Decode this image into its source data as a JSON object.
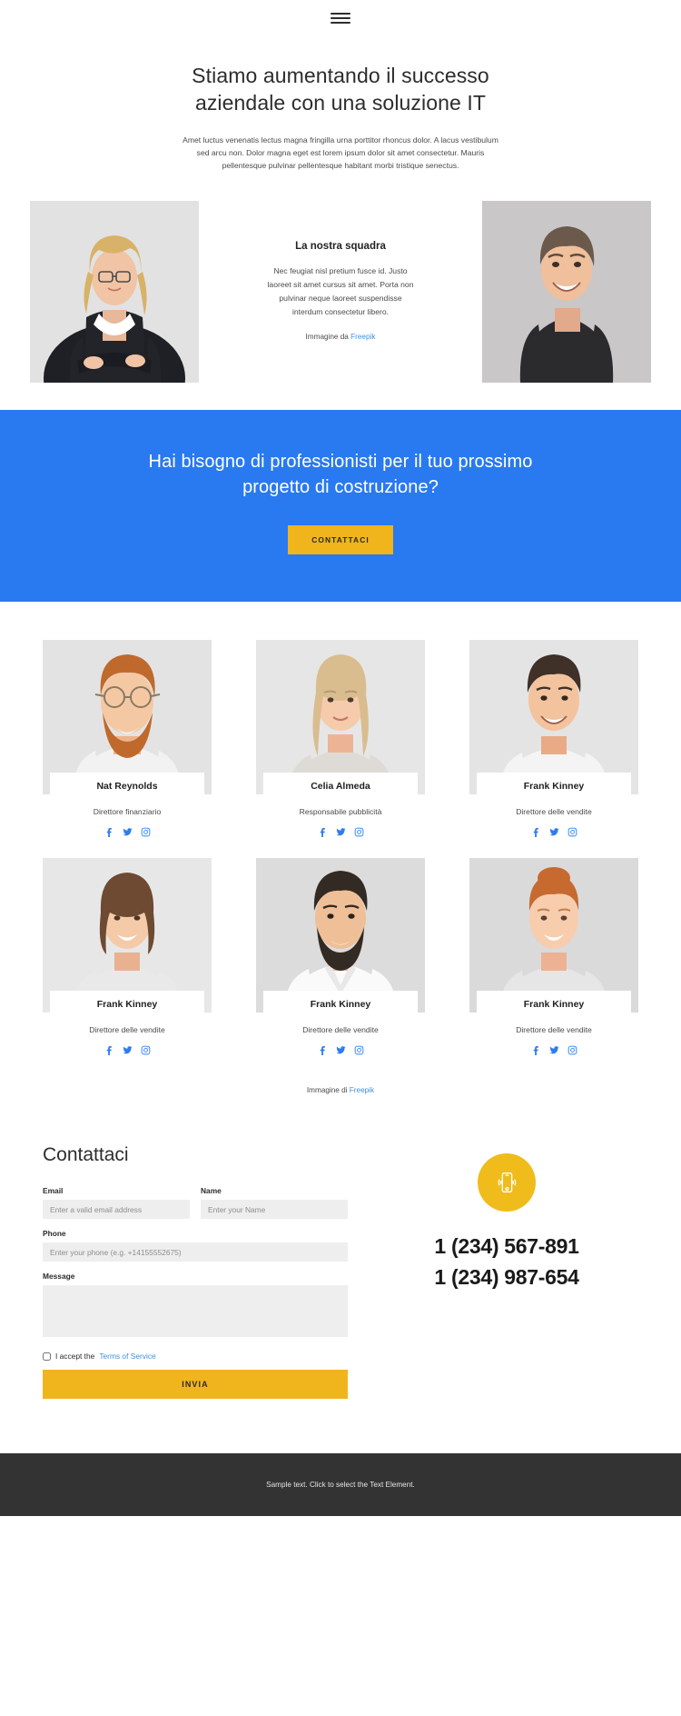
{
  "header": {
    "menu_icon": "hamburger-menu-icon"
  },
  "hero": {
    "title": "Stiamo aumentando il successo aziendale con una soluzione IT",
    "subtitle": "Amet luctus venenatis lectus magna fringilla urna porttitor rhoncus dolor. A lacus vestibulum sed arcu non. Dolor magna eget est lorem ipsum dolor sit amet consectetur. Mauris pellentesque pulvinar pellentesque habitant morbi tristique senectus."
  },
  "intro": {
    "heading": "La nostra squadra",
    "body": "Nec feugiat nisl pretium fusce id. Justo laoreet sit amet cursus sit amet. Porta non pulvinar neque laoreet suspendisse interdum consectetur libero.",
    "credit_prefix": "Immagine da ",
    "credit_link": "Freepik"
  },
  "cta": {
    "heading": "Hai bisogno di professionisti per il tuo prossimo progetto di costruzione?",
    "button_label": "CONTATTACI"
  },
  "team": {
    "members": [
      {
        "name": "Nat Reynolds",
        "role": "Direttore finanziario"
      },
      {
        "name": "Celia Almeda",
        "role": "Responsabile pubblicità"
      },
      {
        "name": "Frank Kinney",
        "role": "Direttore delle vendite"
      },
      {
        "name": "Frank Kinney",
        "role": "Direttore delle vendite"
      },
      {
        "name": "Frank Kinney",
        "role": "Direttore delle vendite"
      },
      {
        "name": "Frank Kinney",
        "role": "Direttore delle vendite"
      }
    ],
    "social_icons": [
      "facebook-icon",
      "twitter-icon",
      "instagram-icon"
    ],
    "credit_prefix": "Immagine di ",
    "credit_link": "Freepik"
  },
  "contact": {
    "title": "Contattaci",
    "fields": {
      "email": {
        "label": "Email",
        "placeholder": "Enter a valid email address",
        "value": ""
      },
      "name": {
        "label": "Name",
        "placeholder": "Enter your Name",
        "value": ""
      },
      "phone": {
        "label": "Phone",
        "placeholder": "Enter your phone (e.g. +14155552675)",
        "value": ""
      },
      "message": {
        "label": "Message",
        "placeholder": "",
        "value": ""
      }
    },
    "accept_text": "I accept the ",
    "terms_link": "Terms of Service",
    "submit_label": "INVIA",
    "phone_icon": "mobile-phone-icon",
    "phone_numbers": [
      "1 (234) 567-891",
      "1 (234) 987-654"
    ]
  },
  "footer": {
    "text": "Sample text. Click to select the Text Element."
  },
  "colors": {
    "accent_blue": "#2979f0",
    "accent_yellow": "#f0b41c",
    "link_blue": "#3d8fe0",
    "footer_bg": "#333333"
  }
}
